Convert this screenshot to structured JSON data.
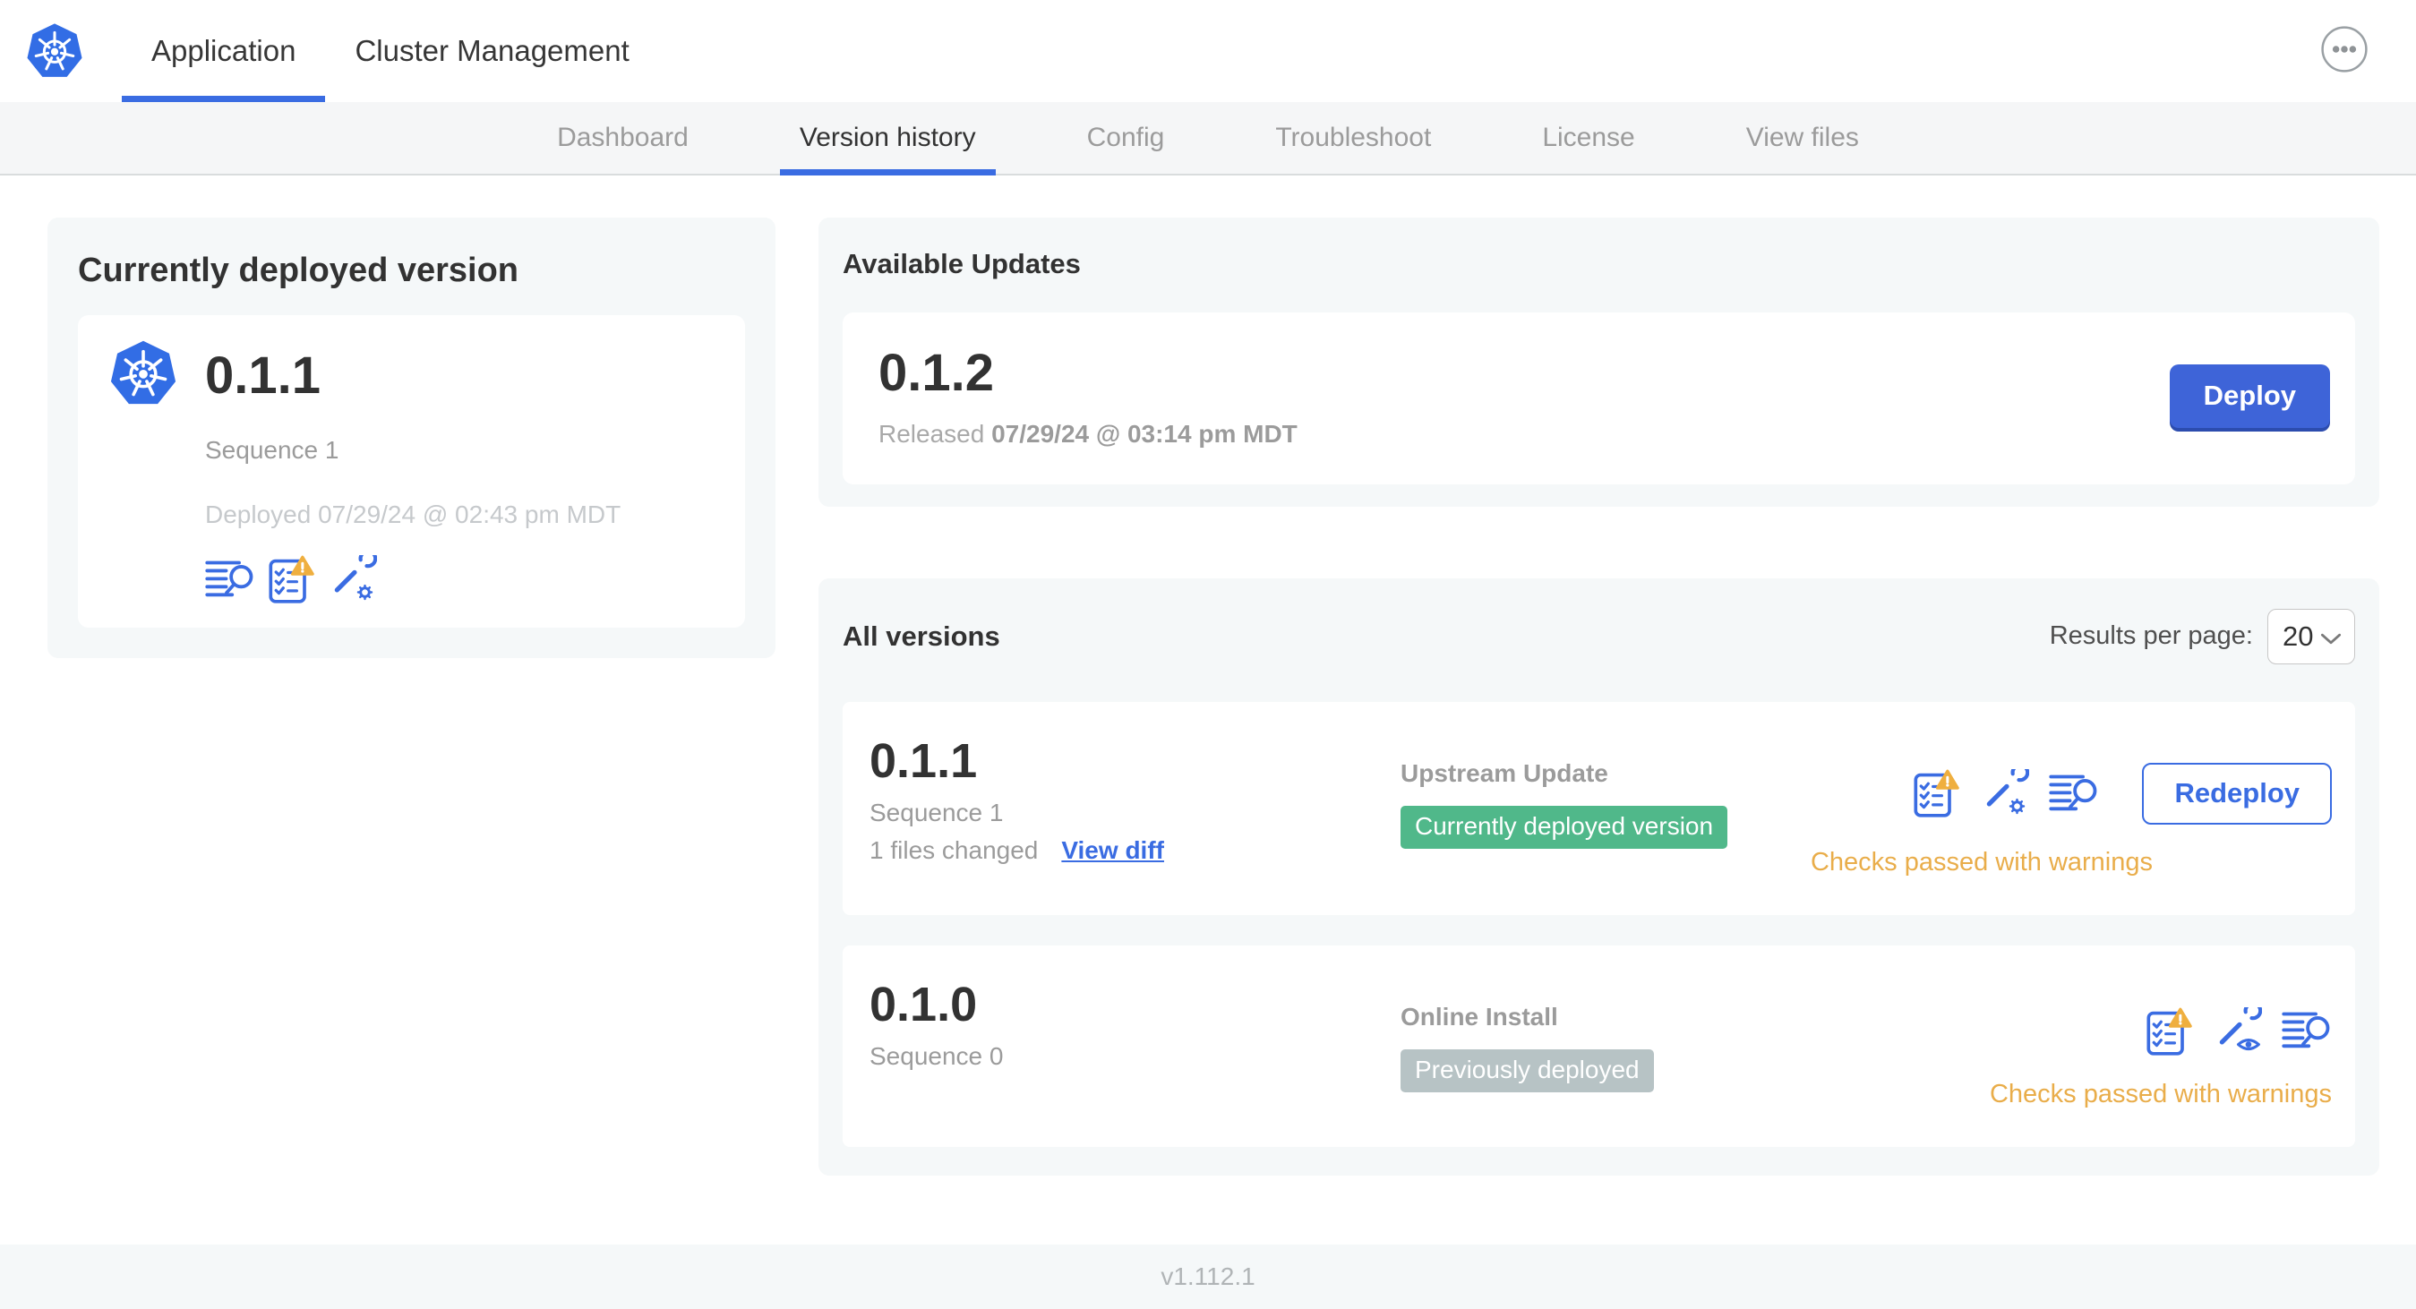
{
  "colors": {
    "accent_blue": "#3a6ce2",
    "deploy_button_blue": "#3e64d8",
    "success_green": "#50b88a",
    "muted_badge_gray": "#b7c3c5",
    "warning_orange": "#e9ad4a",
    "card_background": "#f5f8f9"
  },
  "header": {
    "logo_icon": "kubernetes-logo",
    "menu_icon": "ellipsis-icon",
    "tabs": [
      {
        "label": "Application",
        "active": true
      },
      {
        "label": "Cluster Management",
        "active": false
      }
    ]
  },
  "subnav": {
    "tabs": [
      {
        "label": "Dashboard",
        "active": false
      },
      {
        "label": "Version history",
        "active": true
      },
      {
        "label": "Config",
        "active": false
      },
      {
        "label": "Troubleshoot",
        "active": false
      },
      {
        "label": "License",
        "active": false
      },
      {
        "label": "View files",
        "active": false
      }
    ]
  },
  "current_version": {
    "title": "Currently deployed version",
    "version": "0.1.1",
    "sequence": "Sequence 1",
    "deployed": "Deployed 07/29/24 @ 02:43 pm MDT",
    "icons": [
      "diff-icon",
      "preflight-checks-warning-icon",
      "config-gear-icon"
    ]
  },
  "available_updates": {
    "title": "Available Updates",
    "version": "0.1.2",
    "released_label": "Released",
    "released_date": "07/29/24 @ 03:14 pm MDT",
    "deploy_button": "Deploy"
  },
  "all_versions": {
    "title": "All versions",
    "results_per_page_label": "Results per page:",
    "results_per_page": "20",
    "rows": [
      {
        "version": "0.1.1",
        "sequence": "Sequence 1",
        "files_changed": "1 files changed",
        "view_diff_link": "View diff",
        "source": "Upstream Update",
        "badge": "Currently deployed version",
        "badge_color": "#50b88a",
        "icons": [
          "preflight-checks-warning-icon",
          "config-gear-icon",
          "diff-icon"
        ],
        "status": "Checks passed with warnings",
        "action_button": "Redeploy"
      },
      {
        "version": "0.1.0",
        "sequence": "Sequence 0",
        "source": "Online Install",
        "badge": "Previously deployed",
        "badge_color": "#b7c3c5",
        "icons": [
          "preflight-checks-warning-icon",
          "config-view-icon",
          "diff-icon"
        ],
        "status": "Checks passed with warnings"
      }
    ]
  },
  "footer": {
    "app_version": "v1.112.1"
  }
}
